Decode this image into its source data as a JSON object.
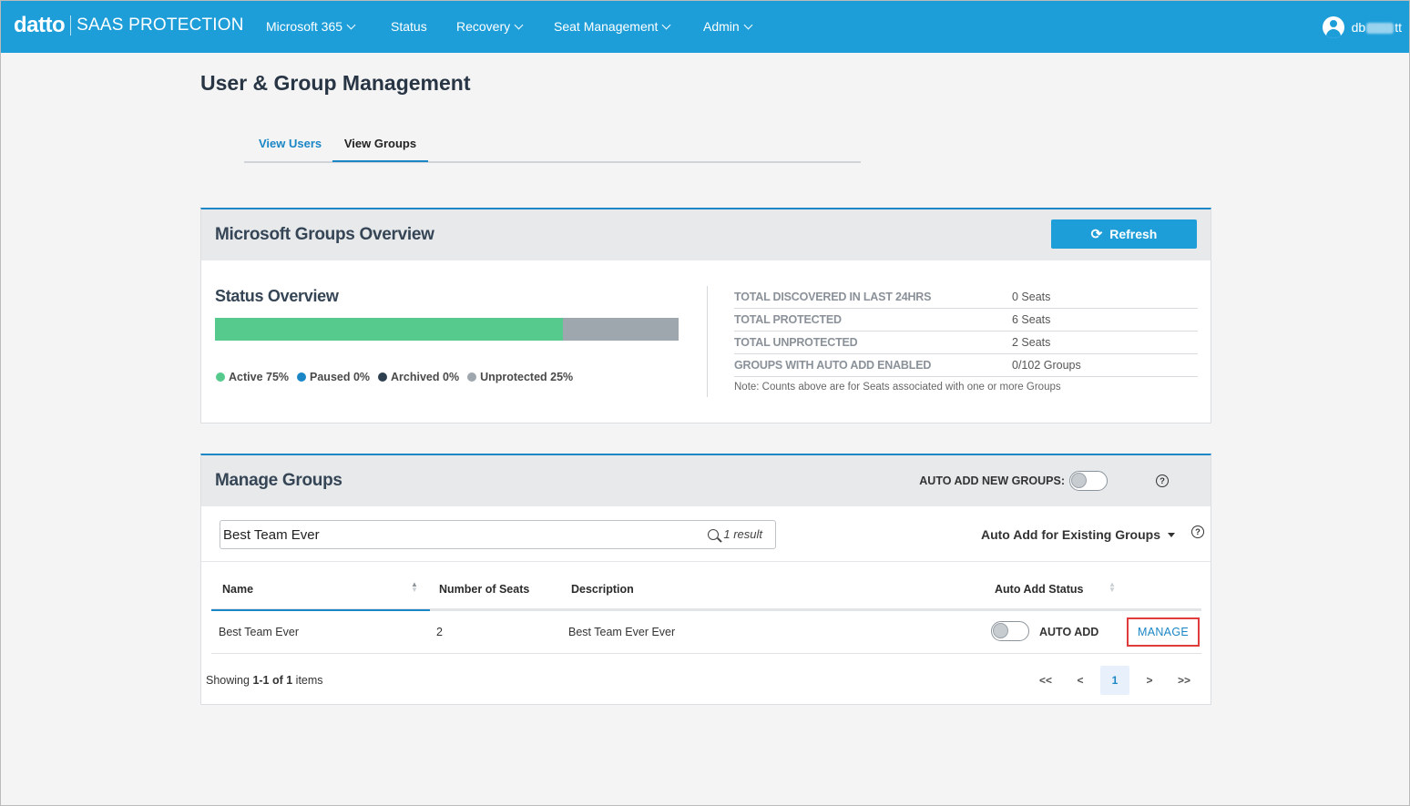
{
  "brand": {
    "logo": "datto",
    "product": "SAAS PROTECTION"
  },
  "nav": [
    {
      "label": "Microsoft 365",
      "dropdown": true
    },
    {
      "label": "Status",
      "dropdown": false
    },
    {
      "label": "Recovery",
      "dropdown": true
    },
    {
      "label": "Seat Management",
      "dropdown": true
    },
    {
      "label": "Admin",
      "dropdown": true
    }
  ],
  "user": {
    "name_start": "db",
    "name_end": "tt",
    "icon": "user-circle-icon"
  },
  "page": {
    "title": "User & Group Management"
  },
  "tabs": [
    {
      "label": "View Users",
      "active": false
    },
    {
      "label": "View Groups",
      "active": true
    }
  ],
  "overview": {
    "title": "Microsoft Groups Overview",
    "refresh_label": "Refresh",
    "status_title": "Status Overview",
    "bar": {
      "active_fraction": 0.75,
      "unprotected_fraction": 0.25
    },
    "legend": [
      {
        "label": "Active 75%",
        "color": "#56c98c"
      },
      {
        "label": "Paused 0%",
        "color": "#1a86c6"
      },
      {
        "label": "Archived 0%",
        "color": "#2e4050"
      },
      {
        "label": "Unprotected 25%",
        "color": "#9fa7ae"
      }
    ],
    "stats": [
      {
        "label": "TOTAL DISCOVERED IN LAST 24HRS",
        "value": "0 Seats"
      },
      {
        "label": "TOTAL PROTECTED",
        "value": "6 Seats"
      },
      {
        "label": "TOTAL UNPROTECTED",
        "value": "2 Seats"
      },
      {
        "label": "GROUPS WITH AUTO ADD ENABLED",
        "value": "0/102 Groups"
      }
    ],
    "note": "Note: Counts above are for Seats associated with one or more Groups"
  },
  "manage": {
    "title": "Manage Groups",
    "auto_add_new_label": "AUTO ADD NEW GROUPS:",
    "auto_add_new_enabled": false,
    "search": {
      "value": "Best Team Ever",
      "result_text": "1 result"
    },
    "auto_existing_label": "Auto Add for Existing Groups",
    "columns": {
      "name": "Name",
      "seats": "Number of Seats",
      "description": "Description",
      "auto_status": "Auto Add Status"
    },
    "rows": [
      {
        "name": "Best Team Ever",
        "seats": "2",
        "description": "Best Team Ever Ever",
        "auto_add_label": "AUTO ADD",
        "auto_add_enabled": false,
        "action": "MANAGE"
      }
    ],
    "showing": {
      "prefix": "Showing ",
      "range": "1-1 of 1",
      "suffix": " items"
    },
    "pager": {
      "first": "<<",
      "prev": "<",
      "current": "1",
      "next": ">",
      "last": ">>"
    }
  },
  "colors": {
    "accent": "#1e9ed9",
    "link": "#1a86c6",
    "highlight": "#e03c3c"
  }
}
